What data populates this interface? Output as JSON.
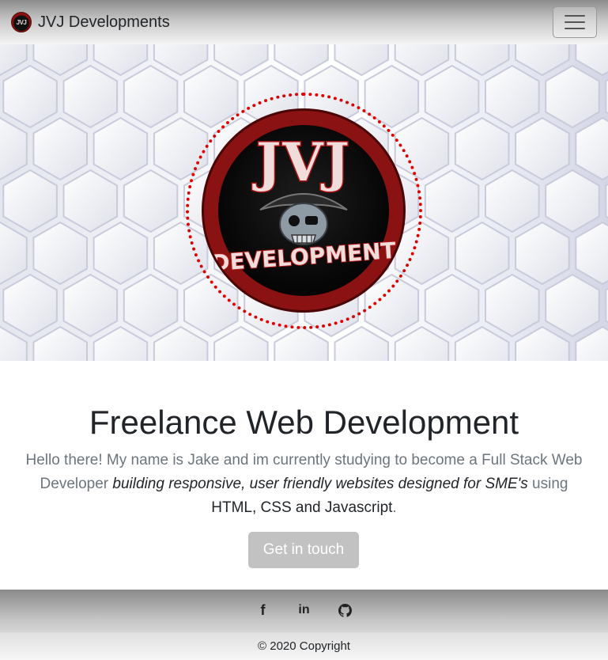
{
  "navbar": {
    "brand_name": "JVJ Developments",
    "brand_logo_text": "JVJ",
    "menu_toggle_icon": "hamburger-icon"
  },
  "hero": {
    "logo_title": "JVJ",
    "logo_subtitle": "DEVELOPMENT",
    "logo_ring_color": "#e00000",
    "logo_disc_color": "#8b1212"
  },
  "main": {
    "heading": "Freelance Web Development",
    "intro_start": "Hello there! My name is Jake and im currently studying to become a Full Stack Web Developer",
    "intro_emphasis": "building responsive, user friendly websites designed for SME's",
    "intro_using": "using",
    "intro_tech": "HTML, CSS and Javascript",
    "intro_end": ".",
    "cta_label": "Get in touch"
  },
  "footer": {
    "social": [
      {
        "icon": "facebook-icon",
        "glyph": "f"
      },
      {
        "icon": "linkedin-icon",
        "glyph": "in"
      },
      {
        "icon": "github-icon"
      }
    ],
    "copyright": "© 2020 Copyright"
  }
}
